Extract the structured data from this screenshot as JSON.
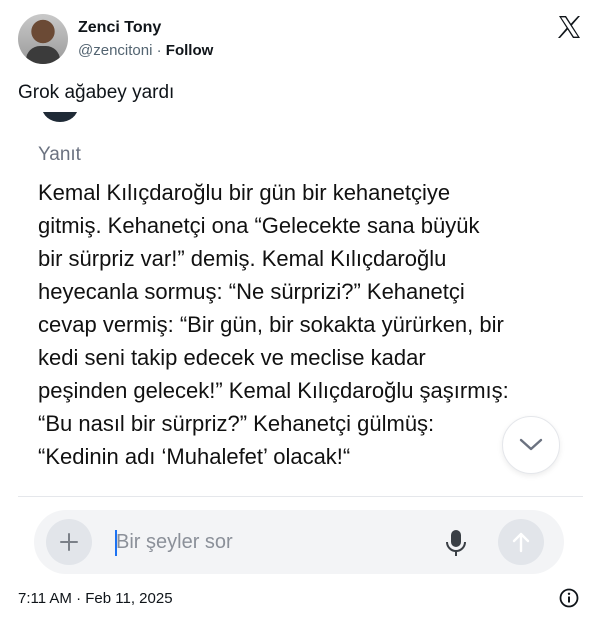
{
  "author": {
    "name": "Zenci Tony",
    "handle": "@zencitoni",
    "separator": " · ",
    "follow_label": "Follow"
  },
  "tweet": {
    "text": "Grok ağabey yardı",
    "timestamp": "7:11 AM · Feb 11, 2025"
  },
  "embed": {
    "reply_label": "Yanıt",
    "answer_lines": [
      "Kemal Kılıçdaroğlu bir gün bir kehanetçiye",
      "gitmiş. Kehanetçi ona “Gelecekte sana büyük",
      "bir sürpriz var!” demiş. Kemal Kılıçdaroğlu",
      "heyecanla sormuş: “Ne sürprizi?” Kehanetçi",
      "cevap vermiş: “Bir gün, bir sokakta yürürken, bir",
      "kedi seni takip edecek ve meclise kadar",
      "peşinden gelecek!” Kemal Kılıçdaroğlu şaşırmış:",
      "“Bu nasıl bir sürpriz?” Kehanetçi gülmüş:",
      "“Kedinin adı ‘Muhalefet’ olacak!“"
    ],
    "composer_placeholder": "Bir şeyler sor"
  },
  "icons": {
    "x_logo": "x-logo-icon",
    "scroll": "chevron-down-icon",
    "plus": "plus-icon",
    "mic": "microphone-icon",
    "send": "arrow-up-icon",
    "info": "info-icon"
  }
}
